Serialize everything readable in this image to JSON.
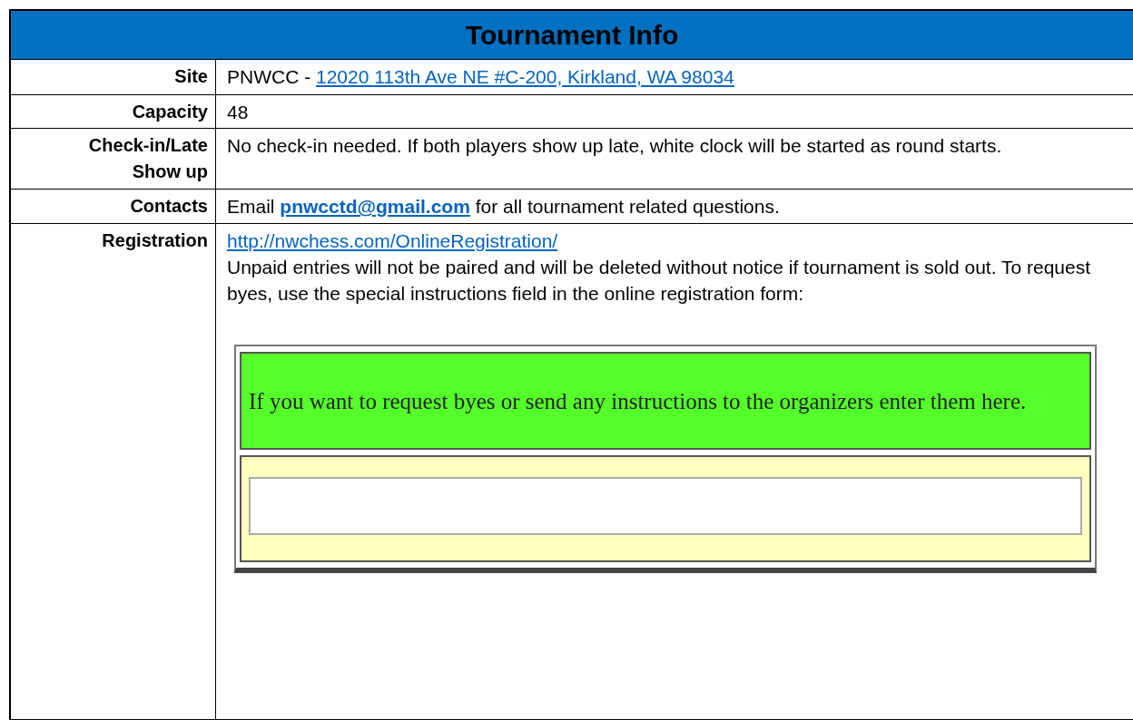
{
  "title": "Tournament Info",
  "rows": [
    {
      "label": "Site",
      "paragraphs": [
        [
          {
            "kind": "text",
            "text": "PNWCC - "
          },
          {
            "kind": "link",
            "text": "12020 113th Ave NE #C-200, Kirkland, WA 98034",
            "bold": false
          }
        ]
      ]
    },
    {
      "label": "Capacity",
      "paragraphs": [
        [
          {
            "kind": "text",
            "text": "48"
          }
        ]
      ]
    },
    {
      "label": "Check-in/Late Show up",
      "paragraphs": [
        [
          {
            "kind": "text",
            "text": "No check-in needed. If both players show up late, white clock will be started as round starts."
          }
        ]
      ]
    },
    {
      "label": "Contacts",
      "paragraphs": [
        [
          {
            "kind": "text",
            "text": "Email "
          },
          {
            "kind": "link",
            "text": "pnwcctd@gmail.com",
            "bold": true
          },
          {
            "kind": "text",
            "text": " for all tournament related questions."
          }
        ]
      ]
    },
    {
      "label": "Registration",
      "paragraphs": [
        [
          {
            "kind": "link",
            "text": "http://nwchess.com/OnlineRegistration/",
            "bold": false
          }
        ],
        [
          {
            "kind": "text",
            "text": "Unpaid entries will not be paired and will be deleted without notice if tournament is sold out. To request byes, use the special instructions field in the online registration form:"
          }
        ]
      ],
      "form": {
        "prompt": "If you want to request byes or send any instructions to the organizers enter them here."
      }
    }
  ]
}
